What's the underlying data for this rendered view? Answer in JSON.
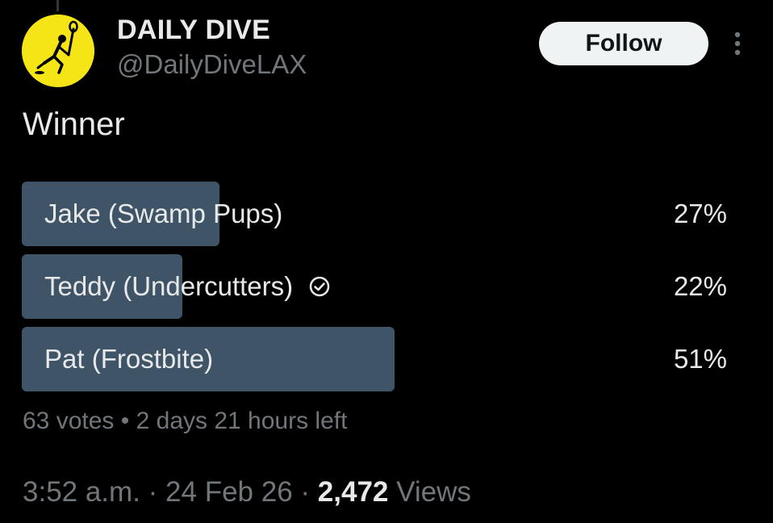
{
  "author": {
    "display_name": "DAILY DIVE",
    "handle": "@DailyDiveLAX",
    "avatar_icon": "lacrosse-player-logo",
    "avatar_color": "#f5e416"
  },
  "follow_label": "Follow",
  "more_icon": "more-vertical-icon",
  "tweet_text": "Winner",
  "poll": {
    "options": [
      {
        "label": "Jake (Swamp Pups)",
        "percent_label": "27%",
        "percent": 27,
        "winner": false
      },
      {
        "label": "Teddy (Undercutters)",
        "percent_label": "22%",
        "percent": 22,
        "winner": false,
        "selected_by_user": true
      },
      {
        "label": "Pat (Frostbite)",
        "percent_label": "51%",
        "percent": 51,
        "winner": true
      }
    ],
    "votes": "63 votes",
    "separator": "•",
    "time_left": "2 days 21 hours left",
    "fill_color": "#3f5466"
  },
  "meta": {
    "time": "3:52 a.m.",
    "sep1": "·",
    "date": "24 Feb 26",
    "sep2": "·",
    "views_count": "2,472",
    "views_label": "Views"
  }
}
